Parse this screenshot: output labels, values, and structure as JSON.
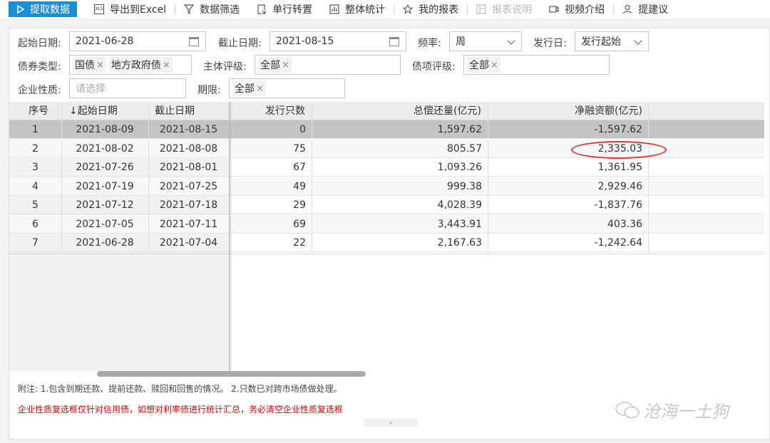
{
  "toolbar": {
    "primary": "提取数据",
    "items": [
      "导出到Excel",
      "数据筛选",
      "单行转置",
      "整体统计",
      "我的报表",
      "报表说明",
      "视频介绍",
      "提建议"
    ],
    "xls_badge": "XLS"
  },
  "filters": {
    "start_label": "起始日期:",
    "start_value": "2021-06-28",
    "end_label": "截止日期:",
    "end_value": "2021-08-15",
    "freq_label": "频率:",
    "freq_value": "周",
    "issue_label": "发行日:",
    "issue_value": "发行起始",
    "bond_type_label": "债券类型:",
    "bond_type_tags": [
      "国债",
      "地方政府债"
    ],
    "issuer_rating_label": "主体评级:",
    "issuer_rating_tags": [
      "全部"
    ],
    "bond_rating_label": "债项评级:",
    "bond_rating_tags": [
      "全部"
    ],
    "nature_label": "企业性质:",
    "nature_placeholder": "请选择",
    "term_label": "期限:",
    "term_tags": [
      "全部"
    ],
    "tag_close": "×"
  },
  "table": {
    "headers": [
      "序号",
      "↓起始日期",
      "截止日期",
      "发行只数",
      "总偿还量(亿元)",
      "净融资额(亿元)"
    ],
    "rows": [
      [
        "1",
        "2021-08-09",
        "2021-08-15",
        "0",
        "1,597.62",
        "-1,597.62"
      ],
      [
        "2",
        "2021-08-02",
        "2021-08-08",
        "75",
        "805.57",
        "2,335.03"
      ],
      [
        "3",
        "2021-07-26",
        "2021-08-01",
        "67",
        "1,093.26",
        "1,361.95"
      ],
      [
        "4",
        "2021-07-19",
        "2021-07-25",
        "49",
        "999.38",
        "2,929.46"
      ],
      [
        "5",
        "2021-07-12",
        "2021-07-18",
        "29",
        "4,028.39",
        "-1,837.76"
      ],
      [
        "6",
        "2021-07-05",
        "2021-07-11",
        "69",
        "3,443.91",
        "403.36"
      ],
      [
        "7",
        "2021-06-28",
        "2021-07-04",
        "22",
        "2,167.63",
        "-1,242.64"
      ]
    ]
  },
  "notes": {
    "note1": "附注: 1.包含到期还款、提前还款、赎回和回售的情况。 2.只数已对跨市场债做处理。",
    "note2": "企业性质复选框仅针对信用债，如想对利率债进行统计汇总，务必清空企业性质复选框",
    "collapse": "⌄"
  },
  "watermark": "沧海一土狗",
  "colors": {
    "primary": "#1b8fd6",
    "warning": "#e00000",
    "highlight_ellipse": "#e53030"
  }
}
